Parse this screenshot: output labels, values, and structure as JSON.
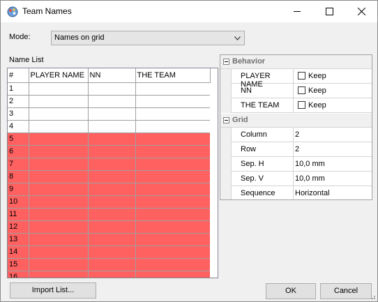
{
  "window": {
    "title": "Team Names",
    "icon": "app-palette-icon"
  },
  "mode": {
    "label": "Mode:",
    "value": "Names on grid"
  },
  "name_list": {
    "label": "Name List",
    "columns": [
      "#",
      "PLAYER NAME",
      "NN",
      "THE TEAM"
    ],
    "rows": [
      {
        "num": "1",
        "player": "",
        "nn": "",
        "team": "",
        "highlight": false
      },
      {
        "num": "2",
        "player": "",
        "nn": "",
        "team": "",
        "highlight": false
      },
      {
        "num": "3",
        "player": "",
        "nn": "",
        "team": "",
        "highlight": false
      },
      {
        "num": "4",
        "player": "",
        "nn": "",
        "team": "",
        "highlight": false
      },
      {
        "num": "5",
        "player": "",
        "nn": "",
        "team": "",
        "highlight": true
      },
      {
        "num": "6",
        "player": "",
        "nn": "",
        "team": "",
        "highlight": true
      },
      {
        "num": "7",
        "player": "",
        "nn": "",
        "team": "",
        "highlight": true
      },
      {
        "num": "8",
        "player": "",
        "nn": "",
        "team": "",
        "highlight": true
      },
      {
        "num": "9",
        "player": "",
        "nn": "",
        "team": "",
        "highlight": true
      },
      {
        "num": "10",
        "player": "",
        "nn": "",
        "team": "",
        "highlight": true
      },
      {
        "num": "11",
        "player": "",
        "nn": "",
        "team": "",
        "highlight": true
      },
      {
        "num": "12",
        "player": "",
        "nn": "",
        "team": "",
        "highlight": true
      },
      {
        "num": "13",
        "player": "",
        "nn": "",
        "team": "",
        "highlight": true
      },
      {
        "num": "14",
        "player": "",
        "nn": "",
        "team": "",
        "highlight": true
      },
      {
        "num": "15",
        "player": "",
        "nn": "",
        "team": "",
        "highlight": true
      },
      {
        "num": "16",
        "player": "",
        "nn": "",
        "team": "",
        "highlight": true
      }
    ],
    "highlight_color": "#ff6161"
  },
  "properties": {
    "behavior": {
      "title": "Behavior",
      "rows": [
        {
          "name": "PLAYER NAME",
          "value": "Keep",
          "checked": false
        },
        {
          "name": "NN",
          "value": "Keep",
          "checked": false
        },
        {
          "name": "THE TEAM",
          "value": "Keep",
          "checked": false
        }
      ]
    },
    "grid": {
      "title": "Grid",
      "rows": [
        {
          "name": "Column",
          "value": "2"
        },
        {
          "name": "Row",
          "value": "2"
        },
        {
          "name": "Sep. H",
          "value": "10,0 mm"
        },
        {
          "name": "Sep. V",
          "value": "10,0 mm"
        },
        {
          "name": "Sequence",
          "value": "Horizontal"
        }
      ]
    }
  },
  "buttons": {
    "import": "Import List...",
    "ok": "OK",
    "cancel": "Cancel"
  }
}
